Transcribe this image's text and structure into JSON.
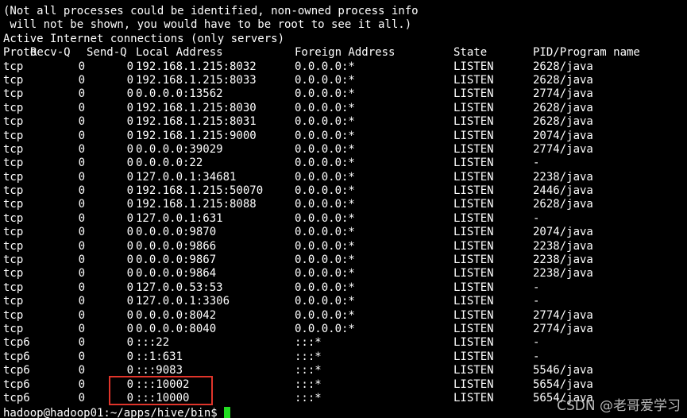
{
  "header_lines": [
    "(Not all processes could be identified, non-owned process info",
    " will not be shown, you would have to be root to see it all.)",
    "Active Internet connections (only servers)"
  ],
  "columns": {
    "proto": "Proto",
    "recvq": "Recv-Q",
    "sendq": "Send-Q",
    "local": "Local Address",
    "foreign": "Foreign Address",
    "state": "State",
    "pid": "PID/Program name"
  },
  "rows": [
    {
      "proto": "tcp",
      "recvq": "0",
      "sendq": "0",
      "local": "192.168.1.215:8032",
      "foreign": "0.0.0.0:*",
      "state": "LISTEN",
      "pid": "2628/java"
    },
    {
      "proto": "tcp",
      "recvq": "0",
      "sendq": "0",
      "local": "192.168.1.215:8033",
      "foreign": "0.0.0.0:*",
      "state": "LISTEN",
      "pid": "2628/java"
    },
    {
      "proto": "tcp",
      "recvq": "0",
      "sendq": "0",
      "local": "0.0.0.0:13562",
      "foreign": "0.0.0.0:*",
      "state": "LISTEN",
      "pid": "2774/java"
    },
    {
      "proto": "tcp",
      "recvq": "0",
      "sendq": "0",
      "local": "192.168.1.215:8030",
      "foreign": "0.0.0.0:*",
      "state": "LISTEN",
      "pid": "2628/java"
    },
    {
      "proto": "tcp",
      "recvq": "0",
      "sendq": "0",
      "local": "192.168.1.215:8031",
      "foreign": "0.0.0.0:*",
      "state": "LISTEN",
      "pid": "2628/java"
    },
    {
      "proto": "tcp",
      "recvq": "0",
      "sendq": "0",
      "local": "192.168.1.215:9000",
      "foreign": "0.0.0.0:*",
      "state": "LISTEN",
      "pid": "2074/java"
    },
    {
      "proto": "tcp",
      "recvq": "0",
      "sendq": "0",
      "local": "0.0.0.0:39029",
      "foreign": "0.0.0.0:*",
      "state": "LISTEN",
      "pid": "2774/java"
    },
    {
      "proto": "tcp",
      "recvq": "0",
      "sendq": "0",
      "local": "0.0.0.0:22",
      "foreign": "0.0.0.0:*",
      "state": "LISTEN",
      "pid": "-"
    },
    {
      "proto": "tcp",
      "recvq": "0",
      "sendq": "0",
      "local": "127.0.0.1:34681",
      "foreign": "0.0.0.0:*",
      "state": "LISTEN",
      "pid": "2238/java"
    },
    {
      "proto": "tcp",
      "recvq": "0",
      "sendq": "0",
      "local": "192.168.1.215:50070",
      "foreign": "0.0.0.0:*",
      "state": "LISTEN",
      "pid": "2446/java"
    },
    {
      "proto": "tcp",
      "recvq": "0",
      "sendq": "0",
      "local": "192.168.1.215:8088",
      "foreign": "0.0.0.0:*",
      "state": "LISTEN",
      "pid": "2628/java"
    },
    {
      "proto": "tcp",
      "recvq": "0",
      "sendq": "0",
      "local": "127.0.0.1:631",
      "foreign": "0.0.0.0:*",
      "state": "LISTEN",
      "pid": "-"
    },
    {
      "proto": "tcp",
      "recvq": "0",
      "sendq": "0",
      "local": "0.0.0.0:9870",
      "foreign": "0.0.0.0:*",
      "state": "LISTEN",
      "pid": "2074/java"
    },
    {
      "proto": "tcp",
      "recvq": "0",
      "sendq": "0",
      "local": "0.0.0.0:9866",
      "foreign": "0.0.0.0:*",
      "state": "LISTEN",
      "pid": "2238/java"
    },
    {
      "proto": "tcp",
      "recvq": "0",
      "sendq": "0",
      "local": "0.0.0.0:9867",
      "foreign": "0.0.0.0:*",
      "state": "LISTEN",
      "pid": "2238/java"
    },
    {
      "proto": "tcp",
      "recvq": "0",
      "sendq": "0",
      "local": "0.0.0.0:9864",
      "foreign": "0.0.0.0:*",
      "state": "LISTEN",
      "pid": "2238/java"
    },
    {
      "proto": "tcp",
      "recvq": "0",
      "sendq": "0",
      "local": "127.0.0.53:53",
      "foreign": "0.0.0.0:*",
      "state": "LISTEN",
      "pid": "-"
    },
    {
      "proto": "tcp",
      "recvq": "0",
      "sendq": "0",
      "local": "127.0.0.1:3306",
      "foreign": "0.0.0.0:*",
      "state": "LISTEN",
      "pid": "-"
    },
    {
      "proto": "tcp",
      "recvq": "0",
      "sendq": "0",
      "local": "0.0.0.0:8042",
      "foreign": "0.0.0.0:*",
      "state": "LISTEN",
      "pid": "2774/java"
    },
    {
      "proto": "tcp",
      "recvq": "0",
      "sendq": "0",
      "local": "0.0.0.0:8040",
      "foreign": "0.0.0.0:*",
      "state": "LISTEN",
      "pid": "2774/java"
    },
    {
      "proto": "tcp6",
      "recvq": "0",
      "sendq": "0",
      "local": ":::22",
      "foreign": ":::*",
      "state": "LISTEN",
      "pid": "-"
    },
    {
      "proto": "tcp6",
      "recvq": "0",
      "sendq": "0",
      "local": "::1:631",
      "foreign": ":::*",
      "state": "LISTEN",
      "pid": "-"
    },
    {
      "proto": "tcp6",
      "recvq": "0",
      "sendq": "0",
      "local": ":::9083",
      "foreign": ":::*",
      "state": "LISTEN",
      "pid": "5546/java"
    },
    {
      "proto": "tcp6",
      "recvq": "0",
      "sendq": "0",
      "local": ":::10002",
      "foreign": ":::*",
      "state": "LISTEN",
      "pid": "5654/java"
    },
    {
      "proto": "tcp6",
      "recvq": "0",
      "sendq": "0",
      "local": ":::10000",
      "foreign": ":::*",
      "state": "LISTEN",
      "pid": "5654/java"
    }
  ],
  "prompt": "hadoop@hadoop01:~/apps/hive/bin$ ",
  "watermark": "CSDN @老哥爱学习",
  "colors": {
    "background": "#000000",
    "text": "#ffffff",
    "cursor": "#22dd22",
    "highlight": "#e0342a"
  }
}
